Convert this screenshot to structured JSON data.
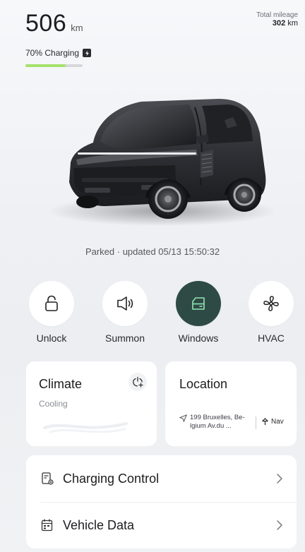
{
  "header": {
    "range_value": "506",
    "range_unit": "km",
    "total_mileage_label": "Total mileage",
    "total_mileage_value": "302",
    "total_mileage_unit": "km",
    "charging_text": "70% Charging",
    "battery_level": 0.7
  },
  "vehicle": {
    "status_text": "Parked · updated 05/13 15:50:32"
  },
  "quick_actions": [
    {
      "label": "Unlock",
      "icon": "unlock-icon",
      "active": false
    },
    {
      "label": "Summon",
      "icon": "horn-icon",
      "active": false
    },
    {
      "label": "Windows",
      "icon": "window-icon",
      "active": true
    },
    {
      "label": "HVAC",
      "icon": "fan-icon",
      "active": false
    }
  ],
  "climate_card": {
    "title": "Climate",
    "status": "Cooling"
  },
  "location_card": {
    "title": "Location",
    "address": "199 Bruxelles, Be-lgium Av.du ...",
    "nav_label": "Nav"
  },
  "list": [
    {
      "label": "Charging Control",
      "icon": "charging-icon"
    },
    {
      "label": "Vehicle Data",
      "icon": "calendar-data-icon"
    }
  ],
  "colors": {
    "accent_active": "#2e4a44",
    "battery_fill": "#a5e26b",
    "background": "#f2f3f5",
    "card": "#ffffff"
  }
}
